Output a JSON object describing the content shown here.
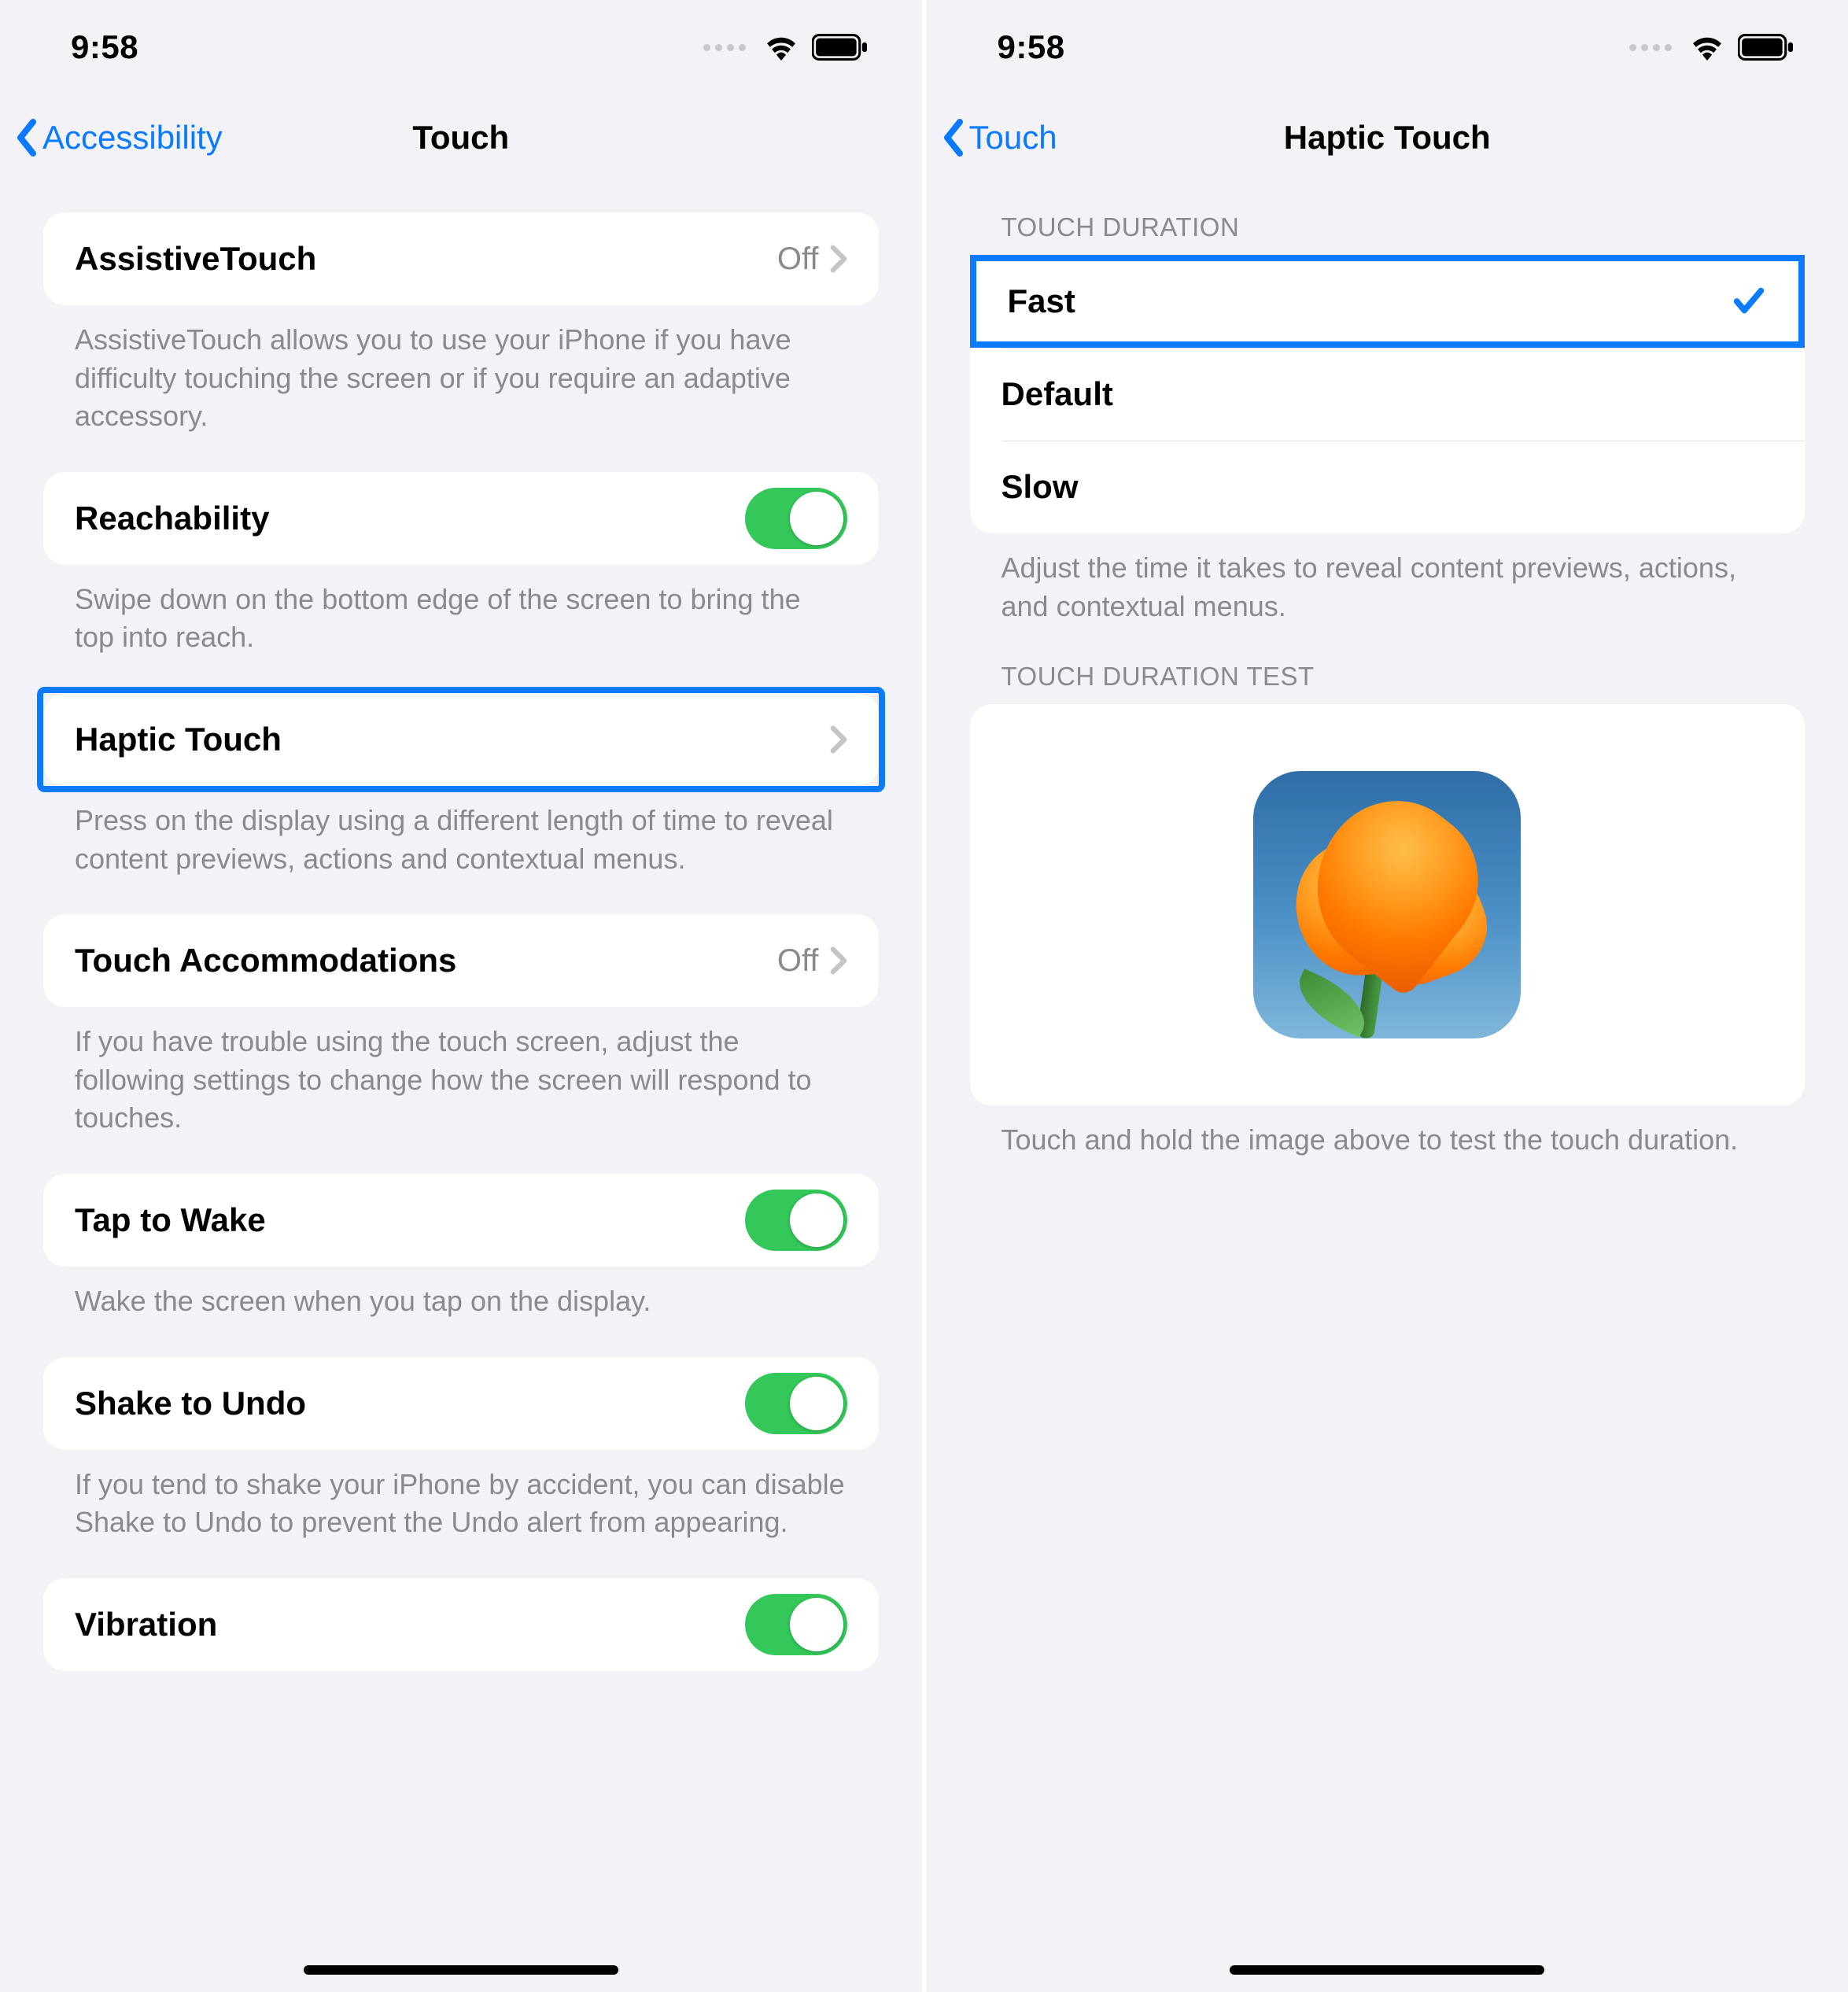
{
  "status": {
    "time": "9:58"
  },
  "left": {
    "nav": {
      "back": "Accessibility",
      "title": "Touch"
    },
    "groups": [
      {
        "cell": {
          "title": "AssistiveTouch",
          "value": "Off"
        },
        "footer": "AssistiveTouch allows you to use your iPhone if you have difficulty touching the screen or if you require an adaptive accessory."
      },
      {
        "cell": {
          "title": "Reachability"
        },
        "footer": "Swipe down on the bottom edge of the screen to bring the top into reach."
      },
      {
        "cell": {
          "title": "Haptic Touch"
        },
        "footer": "Press on the display using a different length of time to reveal content previews, actions and contextual menus."
      },
      {
        "cell": {
          "title": "Touch Accommodations",
          "value": "Off"
        },
        "footer": "If you have trouble using the touch screen, adjust the following settings to change how the screen will respond to touches."
      },
      {
        "cell": {
          "title": "Tap to Wake"
        },
        "footer": "Wake the screen when you tap on the display."
      },
      {
        "cell": {
          "title": "Shake to Undo"
        },
        "footer": "If you tend to shake your iPhone by accident, you can disable Shake to Undo to prevent the Undo alert from appearing."
      },
      {
        "cell": {
          "title": "Vibration"
        }
      }
    ]
  },
  "right": {
    "nav": {
      "back": "Touch",
      "title": "Haptic Touch"
    },
    "duration": {
      "header": "TOUCH DURATION",
      "options": [
        "Fast",
        "Default",
        "Slow"
      ],
      "selected": "Fast",
      "footer": "Adjust the time it takes to reveal content previews, actions, and contextual menus."
    },
    "test": {
      "header": "TOUCH DURATION TEST",
      "footer": "Touch and hold the image above to test the touch duration."
    }
  }
}
